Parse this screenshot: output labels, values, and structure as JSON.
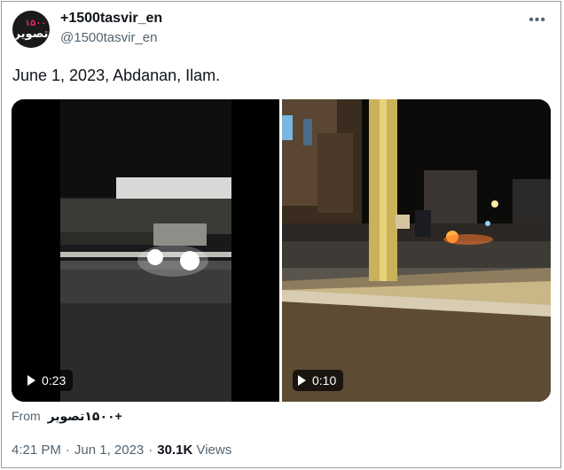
{
  "author": {
    "display_name": "+1500tasvir_en",
    "handle": "@1500tasvir_en",
    "avatar_text": "تصویر",
    "avatar_mark": "۱۵۰۰"
  },
  "tweet": {
    "text": "June 1, 2023, Abdanan, Ilam."
  },
  "media": {
    "videos": [
      {
        "duration": "0:23"
      },
      {
        "duration": "0:10"
      }
    ]
  },
  "source": {
    "prefix": "From",
    "name": "+۱۵۰۰تصویر"
  },
  "meta": {
    "time": "4:21 PM",
    "date": "Jun 1, 2023",
    "views_count": "30.1K",
    "views_label": "Views"
  },
  "colors": {
    "text": "#0f1419",
    "secondary": "#536471"
  }
}
